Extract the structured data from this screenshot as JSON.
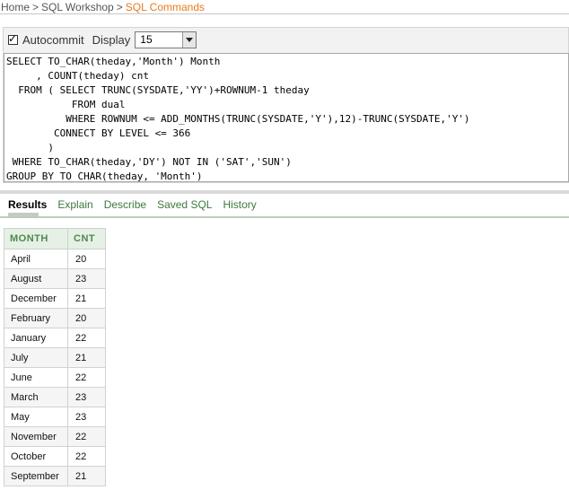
{
  "breadcrumb": {
    "home": "Home",
    "sep": ">",
    "workshop": "SQL Workshop",
    "current": "SQL Commands"
  },
  "toolbar": {
    "autocommit_label": "Autocommit",
    "autocommit_checked": true,
    "display_label": "Display",
    "display_value": "15"
  },
  "sql": {
    "text": "SELECT TO_CHAR(theday,'Month') Month\n     , COUNT(theday) cnt\n  FROM ( SELECT TRUNC(SYSDATE,'YY')+ROWNUM-1 theday\n           FROM dual\n          WHERE ROWNUM <= ADD_MONTHS(TRUNC(SYSDATE,'Y'),12)-TRUNC(SYSDATE,'Y')\n        CONNECT BY LEVEL <= 366\n       )\n WHERE TO_CHAR(theday,'DY') NOT IN ('SAT','SUN')\nGROUP BY TO_CHAR(theday, 'Month')"
  },
  "tabs": [
    {
      "label": "Results",
      "active": true
    },
    {
      "label": "Explain",
      "active": false
    },
    {
      "label": "Describe",
      "active": false
    },
    {
      "label": "Saved SQL",
      "active": false
    },
    {
      "label": "History",
      "active": false
    }
  ],
  "results": {
    "columns": [
      "MONTH",
      "CNT"
    ],
    "rows": [
      {
        "month": "April",
        "cnt": "20"
      },
      {
        "month": "August",
        "cnt": "23"
      },
      {
        "month": "December",
        "cnt": "21"
      },
      {
        "month": "February",
        "cnt": "20"
      },
      {
        "month": "January",
        "cnt": "22"
      },
      {
        "month": "July",
        "cnt": "21"
      },
      {
        "month": "June",
        "cnt": "22"
      },
      {
        "month": "March",
        "cnt": "23"
      },
      {
        "month": "May",
        "cnt": "23"
      },
      {
        "month": "November",
        "cnt": "22"
      },
      {
        "month": "October",
        "cnt": "22"
      },
      {
        "month": "September",
        "cnt": "21"
      }
    ]
  },
  "colors": {
    "breadcrumb_current": "#e87a1e",
    "tab_link": "#3d7a3d",
    "header_text": "#4d8a4d",
    "header_bg": "#e6f0e6"
  }
}
